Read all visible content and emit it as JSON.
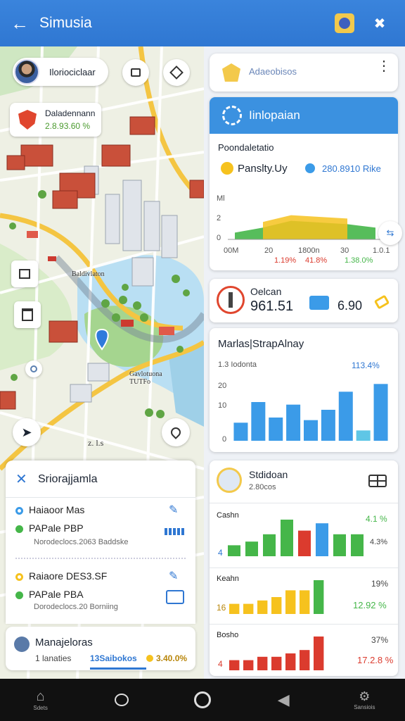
{
  "app": {
    "title": "Simusia"
  },
  "map": {
    "profile_label": "Iloriociclaar",
    "alert": {
      "title": "Daladennann",
      "value": "2.8.93.60 %"
    },
    "label_center": "Baldivlaton",
    "label_south": "Gavlotuona\nTUTFo",
    "label_bottom": "z. l.s"
  },
  "panel": {
    "title": "Sriorajjamla",
    "route1": {
      "from": "Haiaoor Mas",
      "to": "PAPale PBP",
      "detail": "Norodeclocs.2063 Baddske"
    },
    "route2": {
      "from": "Raiaore DES3.SF",
      "to": "PAPale PBA",
      "detail": "Dorodeclocs.20 Borniing"
    },
    "summary": {
      "title": "Manajeloras",
      "a": "1 lanaties",
      "b": "13Saibokos",
      "c": "3.40.0%"
    }
  },
  "right": {
    "search": {
      "label": "Adaeobisos"
    },
    "info": {
      "header": "Iinlopaian",
      "sub": "Poondaletatio",
      "metric_label": "Panslty.Uy",
      "metric_value": "280.8910 Rike",
      "axis_y": [
        "Ml",
        "2",
        "0"
      ],
      "axis_x": [
        "00M",
        "20",
        "1800n",
        "30",
        "1.0.1"
      ],
      "pct": [
        "1.19%",
        "41.8%",
        "1.38.0%"
      ]
    },
    "stat": {
      "label": "Oelcan",
      "value": "961.51",
      "value2": "6.90"
    },
    "chart1": {
      "title": "Marlas|StrapAlnay",
      "left_label": "1.3  Iodonta",
      "right_label": "113.4%",
      "ticks": [
        "20",
        "10",
        "0"
      ]
    },
    "chart2": {
      "title": "Stdidoan",
      "subtitle": "2.80cos",
      "sections": [
        {
          "name": "Cashn",
          "pct": "4.1 %",
          "pct2": "4.3%",
          "lead": "4"
        },
        {
          "name": "Keahn",
          "pct": "19%",
          "pct2": "12.92 %",
          "lead": "16"
        },
        {
          "name": "Bosho",
          "pct": "37%",
          "pct2": "17.2.8 %",
          "lead": "4"
        }
      ]
    }
  },
  "colors": {
    "accent": "#2f77d2",
    "green": "#45b649",
    "yellow": "#f6c21e",
    "red": "#db3b2e",
    "blue": "#3b9be8"
  },
  "chart_data": [
    {
      "type": "area",
      "series": [
        {
          "values": [
            0.2,
            0.35,
            0.55,
            0.5,
            0.45,
            0.35
          ]
        }
      ],
      "ylim": [
        0,
        3
      ]
    },
    {
      "type": "bar",
      "values": [
        7,
        15,
        9,
        14,
        8,
        12,
        19,
        4,
        22
      ],
      "ylim": [
        0,
        30
      ]
    },
    {
      "type": "bar",
      "groups": [
        {
          "values": [
            3,
            4,
            6,
            10,
            7,
            9,
            6,
            6
          ],
          "colors": [
            "#45b649",
            "#45b649",
            "#45b649",
            "#45b649",
            "#db3b2e",
            "#3b9be8",
            "#45b649",
            "#45b649"
          ]
        },
        {
          "values": [
            3,
            3,
            4,
            5,
            7,
            7,
            10
          ],
          "colors": [
            "#f6c21e",
            "#f6c21e",
            "#f6c21e",
            "#f6c21e",
            "#f6c21e",
            "#f6c21e",
            "#45b649"
          ]
        },
        {
          "values": [
            3,
            3,
            4,
            4,
            5,
            6,
            10
          ],
          "colors": [
            "#db3b2e",
            "#db3b2e",
            "#db3b2e",
            "#db3b2e",
            "#db3b2e",
            "#db3b2e",
            "#db3b2e"
          ]
        }
      ]
    }
  ],
  "nav": [
    "Sdets",
    "",
    "",
    "",
    "Sansiois"
  ]
}
